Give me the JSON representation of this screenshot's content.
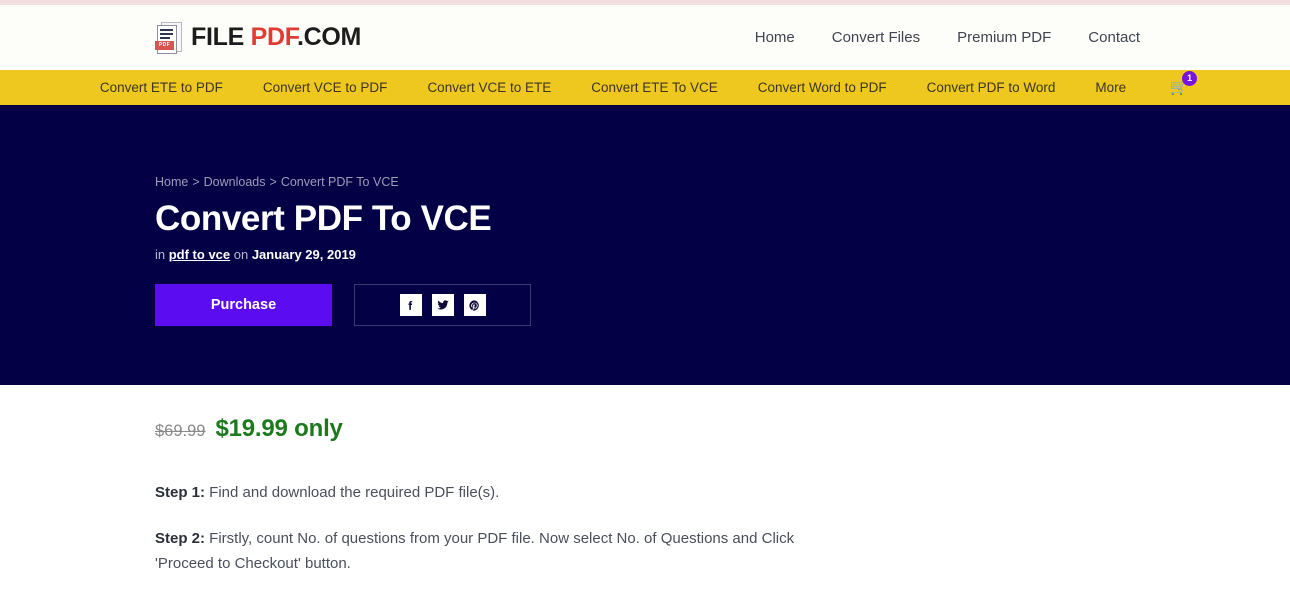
{
  "brand": {
    "name_dark": "FILE ",
    "name_red": "PDF",
    "name_tail": ".COM",
    "logo_badge": "PDF",
    "logo_icon": "pdf-document-icon"
  },
  "header": {
    "nav": [
      {
        "label": "Home"
      },
      {
        "label": "Convert Files"
      },
      {
        "label": "Premium PDF"
      },
      {
        "label": "Contact"
      }
    ]
  },
  "subnav": {
    "items": [
      {
        "label": "Convert ETE to PDF"
      },
      {
        "label": "Convert VCE to PDF"
      },
      {
        "label": "Convert VCE to ETE"
      },
      {
        "label": "Convert ETE To VCE"
      },
      {
        "label": "Convert Word to PDF"
      },
      {
        "label": "Convert PDF to Word"
      },
      {
        "label": "More"
      }
    ],
    "cart": {
      "icon": "shopping-cart-icon",
      "badge_count": "1"
    }
  },
  "hero": {
    "breadcrumb": [
      {
        "label": "Home"
      },
      {
        "label": "Downloads"
      },
      {
        "label": "Convert PDF To VCE"
      }
    ],
    "breadcrumb_separator": ">",
    "title": "Convert PDF To VCE",
    "meta_prefix": "in ",
    "meta_category": "pdf to vce",
    "meta_middle": " on ",
    "meta_date": "January 29, 2019",
    "purchase_label": "Purchase",
    "share": [
      {
        "name": "facebook-icon",
        "label": "f"
      },
      {
        "name": "twitter-icon",
        "label": "t"
      },
      {
        "name": "pinterest-icon",
        "label": "p"
      }
    ]
  },
  "content": {
    "price_old": "$69.99",
    "price_new": "$19.99 only",
    "steps": [
      {
        "label": "Step 1:",
        "text": " Find and download the required PDF file(s)."
      },
      {
        "label": "Step 2:",
        "text": " Firstly, count No. of questions from your PDF file. Now select No. of Questions and Click 'Proceed to Checkout' button."
      }
    ]
  },
  "colors": {
    "navy": "#040046",
    "yellow": "#eec81f",
    "purple": "#5b0cf0",
    "green": "#1c7a1c",
    "brand_red": "#e23b33",
    "badge_purple": "#7a12e0"
  }
}
